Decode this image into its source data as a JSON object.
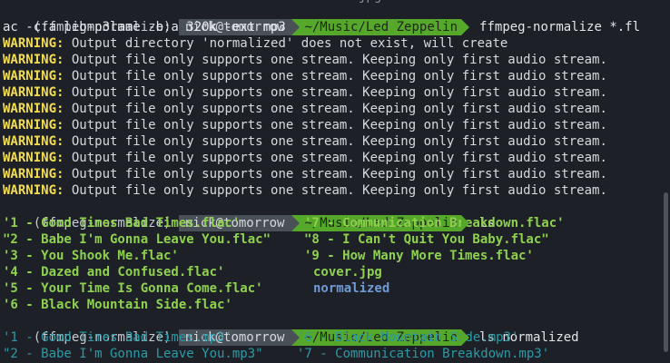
{
  "top_clipped_text": "jpg",
  "prompt": {
    "env": "(ffmpeg-normalize)",
    "user_host": "nick@tomorrow",
    "path": "~/Music/Led Zeppelin"
  },
  "commands": {
    "first_part1": "ffmpeg-normalize *.fl",
    "first_part2": "ac -c:a libmp3lame -b:a 320k -ext mp3",
    "second": "ls",
    "third": "ls normalized"
  },
  "warnings": [
    {
      "label": "WARNING:",
      "message": " Output directory 'normalized' does not exist, will create"
    },
    {
      "label": "WARNING:",
      "message": " Output file only supports one stream. Keeping only first audio stream."
    },
    {
      "label": "WARNING:",
      "message": " Output file only supports one stream. Keeping only first audio stream."
    },
    {
      "label": "WARNING:",
      "message": " Output file only supports one stream. Keeping only first audio stream."
    },
    {
      "label": "WARNING:",
      "message": " Output file only supports one stream. Keeping only first audio stream."
    },
    {
      "label": "WARNING:",
      "message": " Output file only supports one stream. Keeping only first audio stream."
    },
    {
      "label": "WARNING:",
      "message": " Output file only supports one stream. Keeping only first audio stream."
    },
    {
      "label": "WARNING:",
      "message": " Output file only supports one stream. Keeping only first audio stream."
    },
    {
      "label": "WARNING:",
      "message": " Output file only supports one stream. Keeping only first audio stream."
    },
    {
      "label": "WARNING:",
      "message": " Output file only supports one stream. Keeping only first audio stream."
    }
  ],
  "ls_output": {
    "left": [
      "'1 - Good Times Bad Times.flac'",
      "\"2 - Babe I'm Gonna Leave You.flac\"",
      "'3 - You Shook Me.flac'",
      "'4 - Dazed and Confused.flac'",
      "'5 - Your Time Is Gonna Come.flac'",
      "'6 - Black Mountain Side.flac'"
    ],
    "right": [
      "'7 - Communication Breakdown.flac'",
      "\"8 - I Can't Quit You Baby.flac\"",
      "'9 - How Many More Times.flac'",
      "cover.jpg",
      "normalized"
    ]
  },
  "ls_normalized_output": {
    "left": [
      "'1 - Good Times Bad Times.mp3'",
      "\"2 - Babe I'm Gonna Leave You.mp3\""
    ],
    "right": [
      "'6 - Black Mountain Side.mp3'",
      "'7 - Communication Breakdown.mp3'"
    ]
  },
  "colors": {
    "background": "#1d2127",
    "user_segment": "#4a5058",
    "path_segment": "#55a829",
    "warning_label": "#f2dc52",
    "flac_file": "#8fd14f",
    "directory": "#6e9ad6",
    "mp3_file": "#2c9aa6"
  }
}
